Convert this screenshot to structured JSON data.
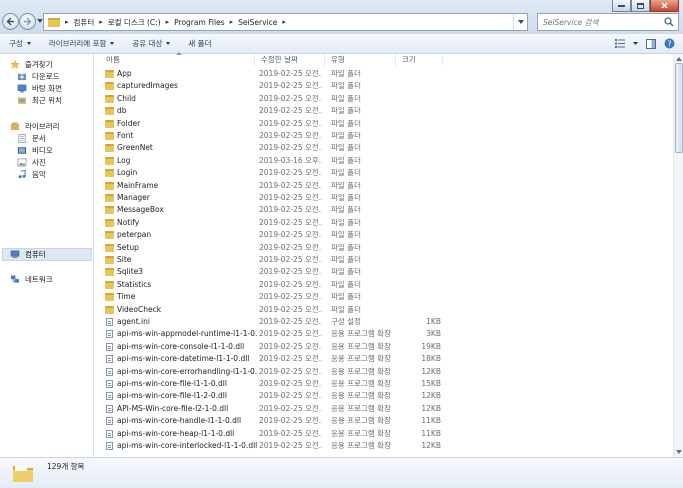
{
  "address": {
    "crumbs": [
      "컴퓨터",
      "로컬 디스크 (C:)",
      "Program Files",
      "SeiService"
    ]
  },
  "search": {
    "placeholder": "SeiService 검색"
  },
  "toolbar": {
    "organize": "구성",
    "include_in_library": "라이브러리에 포함",
    "share_with": "공유 대상",
    "new_folder": "새 폴더"
  },
  "nav": {
    "favorites": "즐겨찾기",
    "downloads": "다운로드",
    "desktop": "바탕 화면",
    "recent": "최근 위치",
    "libraries": "라이브러리",
    "documents": "문서",
    "videos": "비디오",
    "pictures": "사진",
    "music": "음악",
    "computer": "컴퓨터",
    "network": "네트워크"
  },
  "columns": {
    "name": "이름",
    "date": "수정한 날짜",
    "type": "유형",
    "size": "크기"
  },
  "files": [
    {
      "name": "App",
      "date": "2019-02-25 오전...",
      "type": "파일 폴더",
      "size": "",
      "kind": "folder"
    },
    {
      "name": "capturedImages",
      "date": "2019-02-25 오전...",
      "type": "파일 폴더",
      "size": "",
      "kind": "folder"
    },
    {
      "name": "Child",
      "date": "2019-02-25 오전...",
      "type": "파일 폴더",
      "size": "",
      "kind": "folder"
    },
    {
      "name": "db",
      "date": "2019-02-25 오전...",
      "type": "파일 폴더",
      "size": "",
      "kind": "folder"
    },
    {
      "name": "Folder",
      "date": "2019-02-25 오전...",
      "type": "파일 폴더",
      "size": "",
      "kind": "folder"
    },
    {
      "name": "Font",
      "date": "2019-02-25 오전...",
      "type": "파일 폴더",
      "size": "",
      "kind": "folder"
    },
    {
      "name": "GreenNet",
      "date": "2019-02-25 오전...",
      "type": "파일 폴더",
      "size": "",
      "kind": "folder"
    },
    {
      "name": "Log",
      "date": "2019-03-16 오후...",
      "type": "파일 폴더",
      "size": "",
      "kind": "folder"
    },
    {
      "name": "Login",
      "date": "2019-02-25 오전...",
      "type": "파일 폴더",
      "size": "",
      "kind": "folder"
    },
    {
      "name": "MainFrame",
      "date": "2019-02-25 오전...",
      "type": "파일 폴더",
      "size": "",
      "kind": "folder"
    },
    {
      "name": "Manager",
      "date": "2019-02-25 오전...",
      "type": "파일 폴더",
      "size": "",
      "kind": "folder"
    },
    {
      "name": "MessageBox",
      "date": "2019-02-25 오전...",
      "type": "파일 폴더",
      "size": "",
      "kind": "folder"
    },
    {
      "name": "Notify",
      "date": "2019-02-25 오전...",
      "type": "파일 폴더",
      "size": "",
      "kind": "folder"
    },
    {
      "name": "peterpan",
      "date": "2019-02-25 오전...",
      "type": "파일 폴더",
      "size": "",
      "kind": "folder"
    },
    {
      "name": "Setup",
      "date": "2019-02-25 오전...",
      "type": "파일 폴더",
      "size": "",
      "kind": "folder"
    },
    {
      "name": "Site",
      "date": "2019-02-25 오전...",
      "type": "파일 폴더",
      "size": "",
      "kind": "folder"
    },
    {
      "name": "Sqlite3",
      "date": "2019-02-25 오전...",
      "type": "파일 폴더",
      "size": "",
      "kind": "folder"
    },
    {
      "name": "Statistics",
      "date": "2019-02-25 오전...",
      "type": "파일 폴더",
      "size": "",
      "kind": "folder"
    },
    {
      "name": "Time",
      "date": "2019-02-25 오전...",
      "type": "파일 폴더",
      "size": "",
      "kind": "folder"
    },
    {
      "name": "VideoCheck",
      "date": "2019-02-25 오전...",
      "type": "파일 폴더",
      "size": "",
      "kind": "folder"
    },
    {
      "name": "agent.ini",
      "date": "2019-02-25 오전...",
      "type": "구성 설정",
      "size": "1KB",
      "kind": "file"
    },
    {
      "name": "api-ms-win-appmodel-runtime-l1-1-0.dll",
      "date": "2019-02-25 오전...",
      "type": "응용 프로그램 확장",
      "size": "3KB",
      "kind": "file"
    },
    {
      "name": "api-ms-win-core-console-l1-1-0.dll",
      "date": "2019-02-25 오전...",
      "type": "응용 프로그램 확장",
      "size": "19KB",
      "kind": "file"
    },
    {
      "name": "api-ms-win-core-datetime-l1-1-0.dll",
      "date": "2019-02-25 오전...",
      "type": "응용 프로그램 확장",
      "size": "18KB",
      "kind": "file"
    },
    {
      "name": "api-ms-win-core-errorhandling-l1-1-0.dll",
      "date": "2019-02-25 오전...",
      "type": "응용 프로그램 확장",
      "size": "12KB",
      "kind": "file"
    },
    {
      "name": "api-ms-win-core-file-l1-1-0.dll",
      "date": "2019-02-25 오전...",
      "type": "응용 프로그램 확장",
      "size": "15KB",
      "kind": "file"
    },
    {
      "name": "api-ms-win-core-file-l1-2-0.dll",
      "date": "2019-02-25 오전...",
      "type": "응용 프로그램 확장",
      "size": "12KB",
      "kind": "file"
    },
    {
      "name": "API-MS-Win-core-file-l2-1-0.dll",
      "date": "2019-02-25 오전...",
      "type": "응용 프로그램 확장",
      "size": "12KB",
      "kind": "file"
    },
    {
      "name": "api-ms-win-core-handle-l1-1-0.dll",
      "date": "2019-02-25 오전...",
      "type": "응용 프로그램 확장",
      "size": "11KB",
      "kind": "file"
    },
    {
      "name": "api-ms-win-core-heap-l1-1-0.dll",
      "date": "2019-02-25 오전...",
      "type": "응용 프로그램 확장",
      "size": "11KB",
      "kind": "file"
    },
    {
      "name": "api-ms-win-core-interlocked-l1-1-0.dll",
      "date": "2019-02-25 오전...",
      "type": "응용 프로그램 확장",
      "size": "12KB",
      "kind": "file"
    }
  ],
  "status": {
    "item_count": "129개 항목"
  },
  "colors": {
    "folder": "#e9c458",
    "header_text": "#4c607a",
    "toolbar_text": "#1e395b"
  },
  "icons": {
    "back": "back-arrow-icon",
    "forward": "forward-arrow-icon",
    "search": "search-icon",
    "views": "view-options-icon",
    "preview": "preview-pane-icon",
    "help": "help-icon"
  }
}
